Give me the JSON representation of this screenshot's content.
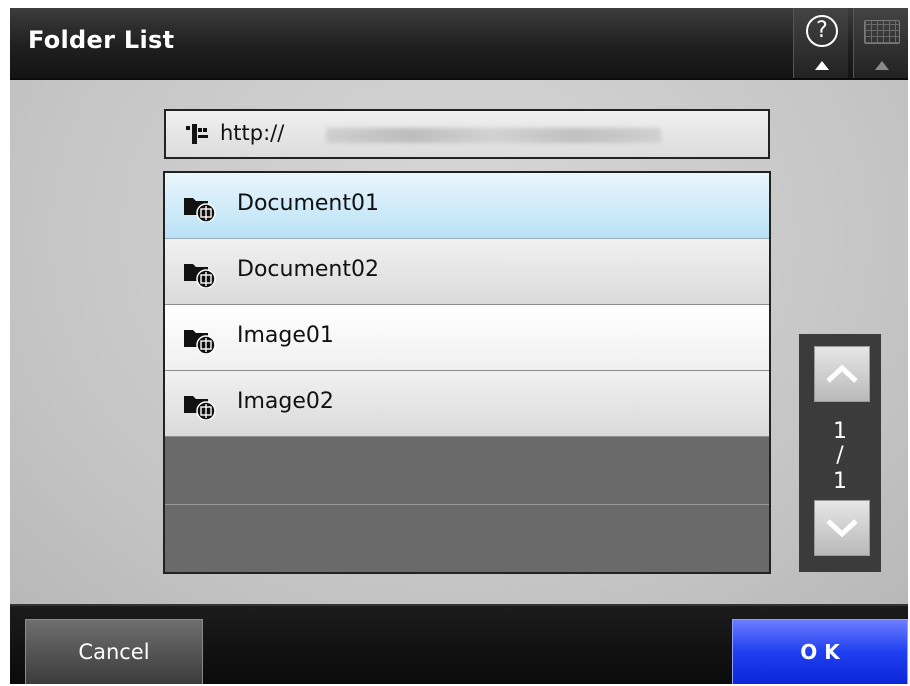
{
  "window": {
    "title": "Folder List"
  },
  "toolbar": {
    "help_icon": "question-circle-icon",
    "keyboard_icon": "keyboard-icon",
    "help_glyph": "?"
  },
  "path": {
    "prefix": "http://",
    "icon": "network-tree-icon"
  },
  "folders": [
    {
      "label": "Document01",
      "icon": "network-folder-icon",
      "selected": true
    },
    {
      "label": "Document02",
      "icon": "network-folder-icon",
      "selected": false
    },
    {
      "label": "Image01",
      "icon": "network-folder-icon",
      "selected": false
    },
    {
      "label": "Image02",
      "icon": "network-folder-icon",
      "selected": false
    }
  ],
  "pager": {
    "current": "1",
    "separator": "/",
    "total": "1"
  },
  "footer": {
    "cancel_label": "Cancel",
    "ok_label": "O K"
  },
  "colors": {
    "selected_row": "#b9e2f6",
    "ok_button": "#1f3ff0",
    "titlebar": "#1f1f1f"
  }
}
